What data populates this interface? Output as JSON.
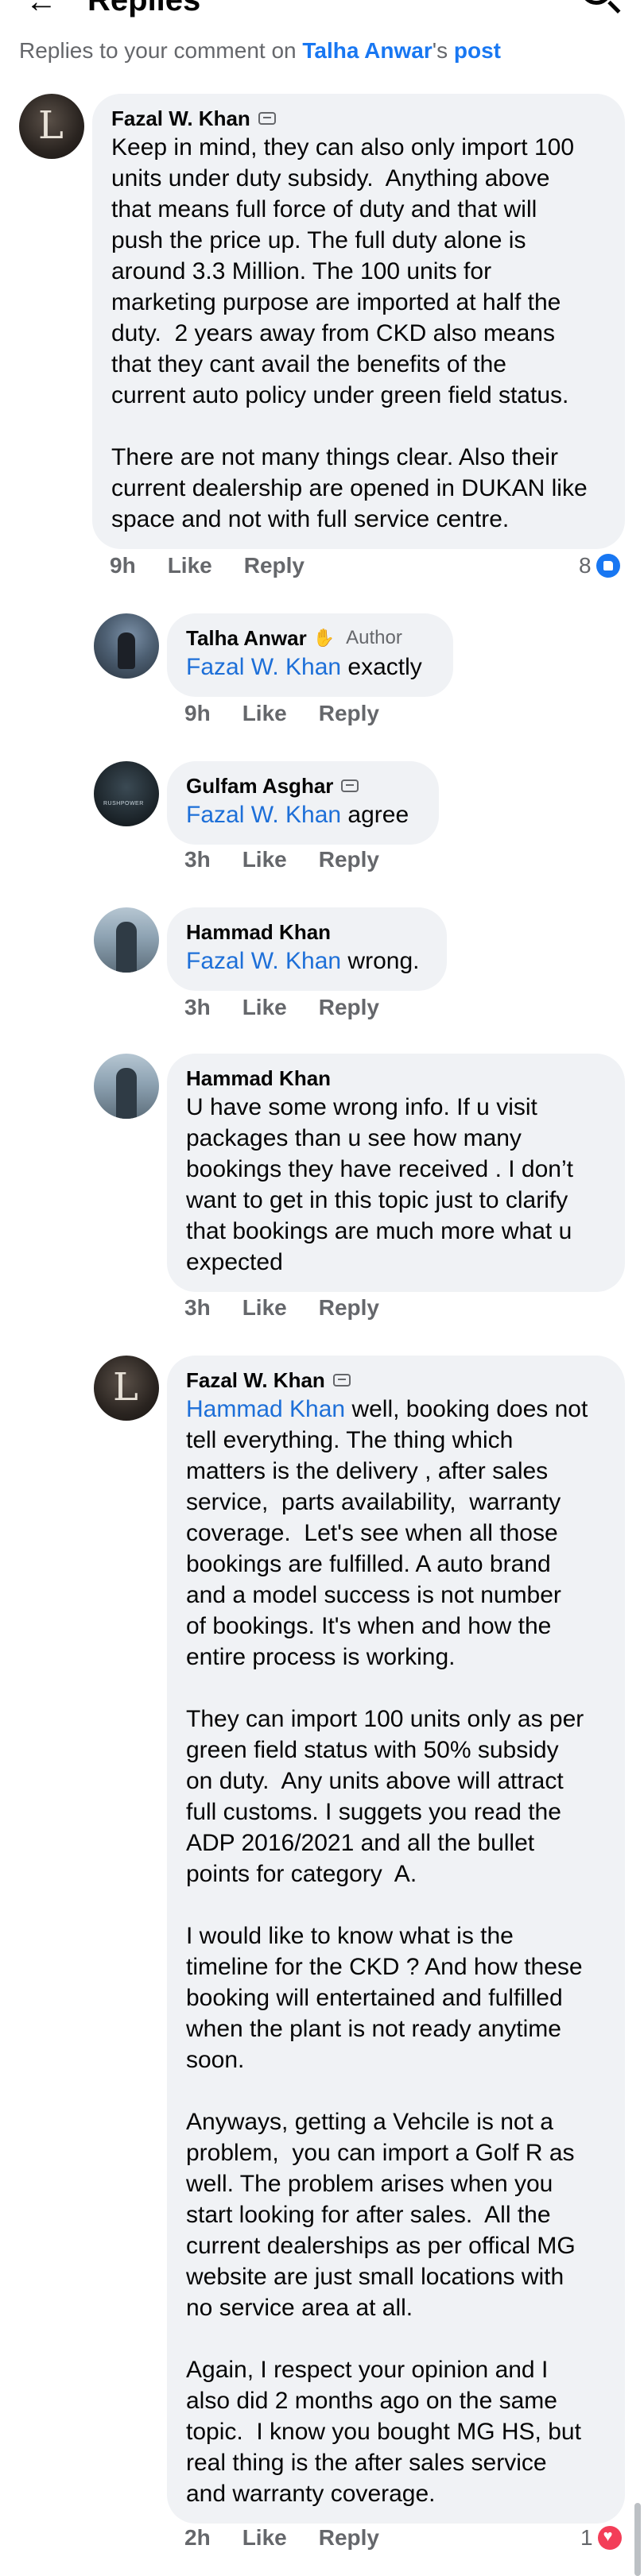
{
  "header": {
    "back_icon": "back-arrow-icon",
    "title": "Replies",
    "search_icon": "search-icon"
  },
  "context": {
    "prefix": "Replies to your comment on ",
    "author": "Talha Anwar",
    "possessive": "'s ",
    "post_link": "post"
  },
  "comments": [
    {
      "name": "Fazal W. Khan",
      "badge": "badge-icon",
      "mention": "",
      "text": "Keep in mind, they can also only import 100\nunits under duty subsidy.  Anything above\nthat means full force of duty and that will\npush the price up. The full duty alone is\naround 3.3 Million. The 100 units for\nmarketing purpose are imported at half the\nduty.  2 years away from CKD also means\nthat they cant avail the benefits of the\ncurrent auto policy under green field status.\n\nThere are not many things clear. Also their\ncurrent dealership are opened in DUKAN like\nspace and not with full service centre.",
      "time": "9h",
      "like": "Like",
      "reply": "Reply",
      "reaction_count": "8",
      "reaction_icon": "like-reaction-icon"
    },
    {
      "name": "Talha Anwar",
      "badge": "wave-icon",
      "role": "Author",
      "mention": "Fazal W. Khan",
      "text": " exactly",
      "time": "9h",
      "like": "Like",
      "reply": "Reply"
    },
    {
      "name": "Gulfam Asghar",
      "badge": "badge-icon",
      "mention": "Fazal W. Khan",
      "text": " agree",
      "time": "3h",
      "like": "Like",
      "reply": "Reply"
    },
    {
      "name": "Hammad Khan",
      "mention": "Fazal W. Khan",
      "text": " wrong.",
      "time": "3h",
      "like": "Like",
      "reply": "Reply"
    },
    {
      "name": "Hammad Khan",
      "mention": "",
      "text": "U have some wrong info. If u visit\npackages than u see how many\nbookings they have received . I don’t\nwant to get in this topic just to clarify\nthat bookings are much more what u\nexpected",
      "time": "3h",
      "like": "Like",
      "reply": "Reply"
    },
    {
      "name": "Fazal W. Khan",
      "badge": "badge-icon",
      "mention": "Hammad Khan",
      "text": " well, booking does not\ntell everything. The thing which\nmatters is the delivery , after sales\nservice,  parts availability,  warranty\ncoverage.  Let's see when all those\nbookings are fulfilled. A auto brand\nand a model success is not number\nof bookings. It's when and how the\nentire process is working.\n\nThey can import 100 units only as per\ngreen field status with 50% subsidy\non duty.  Any units above will attract\nfull customs. I suggets you read the\nADP 2016/2021 and all the bullet\npoints for category  A.\n\nI would like to know what is the\ntimeline for the CKD ? And how these\nbooking will entertained and fulfilled\nwhen the plant is not ready anytime\nsoon.\n\nAnyways, getting a Vehcile is not a\nproblem,  you can import a Golf R as\nwell. The problem arises when you\nstart looking for after sales.  All the\ncurrent dealerships as per offical MG\nwebsite are just small locations with\nno service area at all.\n\nAgain, I respect your opinion and I\nalso did 2 months ago on the same\ntopic.  I know you bought MG HS, but\nreal thing is the after sales service\nand warranty coverage.",
      "time": "2h",
      "like": "Like",
      "reply": "Reply",
      "reaction_count": "1",
      "reaction_icon": "love-reaction-icon"
    }
  ]
}
